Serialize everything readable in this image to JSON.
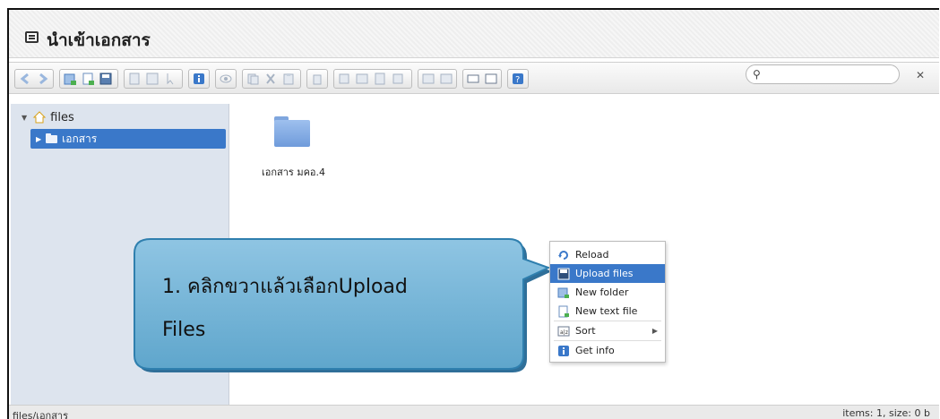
{
  "window": {
    "title": "นำเข้าเอกสาร"
  },
  "search": {
    "placeholder": ""
  },
  "sidebar": {
    "root_label": "files",
    "items": [
      {
        "label": "เอกสาร"
      }
    ]
  },
  "main": {
    "items": [
      {
        "name": "เอกสาร มคอ.4",
        "icon": "folder-icon"
      }
    ]
  },
  "context_menu": {
    "items": [
      {
        "label": "Reload",
        "icon": "reload-icon"
      },
      {
        "label": "Upload files",
        "icon": "upload-icon",
        "highlighted": true
      },
      {
        "label": "New folder",
        "icon": "new-folder-icon"
      },
      {
        "label": "New text file",
        "icon": "new-file-icon"
      },
      {
        "label": "Sort",
        "icon": "sort-icon",
        "submenu": true
      },
      {
        "label": "Get info",
        "icon": "info-icon"
      }
    ]
  },
  "callout": {
    "line1": "1. คลิกขวาแล้วเลือกUpload",
    "line2": "Files"
  },
  "status": {
    "path": "files/เอกสาร",
    "summary": "items: 1, size: 0 b"
  },
  "colors": {
    "accent": "#3a78c9",
    "callout_fill": "#6fb3d6",
    "callout_border": "#2f7fae"
  }
}
